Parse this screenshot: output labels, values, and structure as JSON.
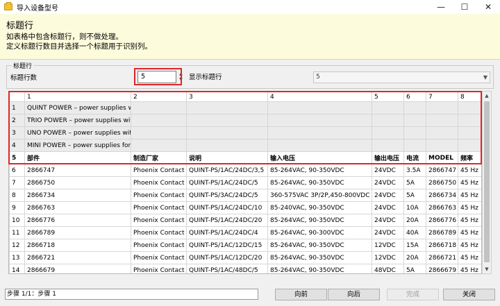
{
  "window": {
    "title": "导入设备型号",
    "minimize_glyph": "—",
    "maximize_glyph": "☐",
    "close_glyph": "✕"
  },
  "banner": {
    "title": "标题行",
    "line1": "如表格中包含标题行，则不做处理。",
    "line2": "定义标题行数目并选择一个标题用于识别列。"
  },
  "group": {
    "legend": "标题行",
    "rows_label": "标题行数",
    "rows_value": "5",
    "show_label": "显示标题行",
    "show_value": "5"
  },
  "grid": {
    "column_headers": [
      "1",
      "2",
      "3",
      "4",
      "5",
      "6",
      "7",
      "8"
    ],
    "title_rows": [
      {
        "num": "1",
        "cells": [
          "QUINT POWER – power supplies wi",
          "",
          "",
          "",
          "",
          "",
          "",
          ""
        ]
      },
      {
        "num": "2",
        "cells": [
          "TRIO POWER – power supplies wit",
          "",
          "",
          "",
          "",
          "",
          "",
          ""
        ]
      },
      {
        "num": "3",
        "cells": [
          "UNO POWER – power supplies wit",
          "",
          "",
          "",
          "",
          "",
          "",
          ""
        ]
      },
      {
        "num": "4",
        "cells": [
          "MINI POWER – power supplies for",
          "",
          "",
          "",
          "",
          "",
          "",
          ""
        ]
      }
    ],
    "header_row": {
      "num": "5",
      "cells": [
        "部件",
        "制造厂家",
        "说明",
        "输入电压",
        "输出电压",
        "电流",
        "MODEL",
        "频率"
      ]
    },
    "rows": [
      {
        "num": "6",
        "cells": [
          "2866747",
          "Phoenix Contact",
          "QUINT-PS/1AC/24DC/3,5",
          "85-264VAC, 90-350VDC",
          "24VDC",
          "3.5A",
          "2866747",
          "45 Hz"
        ]
      },
      {
        "num": "7",
        "cells": [
          "2866750",
          "Phoenix Contact",
          "QUINT-PS/1AC/24DC/5",
          "85-264VAC, 90-350VDC",
          "24VDC",
          "5A",
          "2866750",
          "45 Hz"
        ]
      },
      {
        "num": "8",
        "cells": [
          "2866734",
          "Phoenix Contact",
          "QUINT-PS/3AC/24DC/5",
          "360-575VAC 3P/2P,450-800VDC",
          "24VDC",
          "5A",
          "2866734",
          "45 Hz"
        ]
      },
      {
        "num": "9",
        "cells": [
          "2866763",
          "Phoenix Contact",
          "QUINT-PS/1AC/24DC/10",
          "85-240VAC, 90-350VDC",
          "24VDC",
          "10A",
          "2866763",
          "45 Hz"
        ]
      },
      {
        "num": "10",
        "cells": [
          "2866776",
          "Phoenix Contact",
          "QUINT-PS/1AC/24DC/20",
          "85-264VAC, 90-350VDC",
          "24VDC",
          "20A",
          "2866776",
          "45 Hz"
        ]
      },
      {
        "num": "11",
        "cells": [
          "2866789",
          "Phoenix Contact",
          "QUINT-PS/1AC/24DC/4",
          "85-264VAC, 90-300VDC",
          "24VDC",
          "40A",
          "2866789",
          "45 Hz"
        ]
      },
      {
        "num": "12",
        "cells": [
          "2866718",
          "Phoenix Contact",
          "QUINT-PS/1AC/12DC/15",
          "85-264VAC, 90-350VDC",
          "12VDC",
          "15A",
          "2866718",
          "45 Hz"
        ]
      },
      {
        "num": "13",
        "cells": [
          "2866721",
          "Phoenix Contact",
          "QUINT-PS/1AC/12DC/20",
          "85-264VAC, 90-350VDC",
          "12VDC",
          "20A",
          "2866721",
          "45 Hz"
        ]
      },
      {
        "num": "14",
        "cells": [
          "2866679",
          "Phoenix Contact",
          "QUINT-PS/1AC/48DC/5",
          "85-264VAC, 90-350VDC",
          "48VDC",
          "5A",
          "2866679",
          "45 Hz"
        ]
      }
    ]
  },
  "status": {
    "text": "步骤 1/1：步骤 1"
  },
  "buttons": {
    "back": "向前",
    "next": "向后",
    "finish": "完成",
    "close": "关闭"
  }
}
